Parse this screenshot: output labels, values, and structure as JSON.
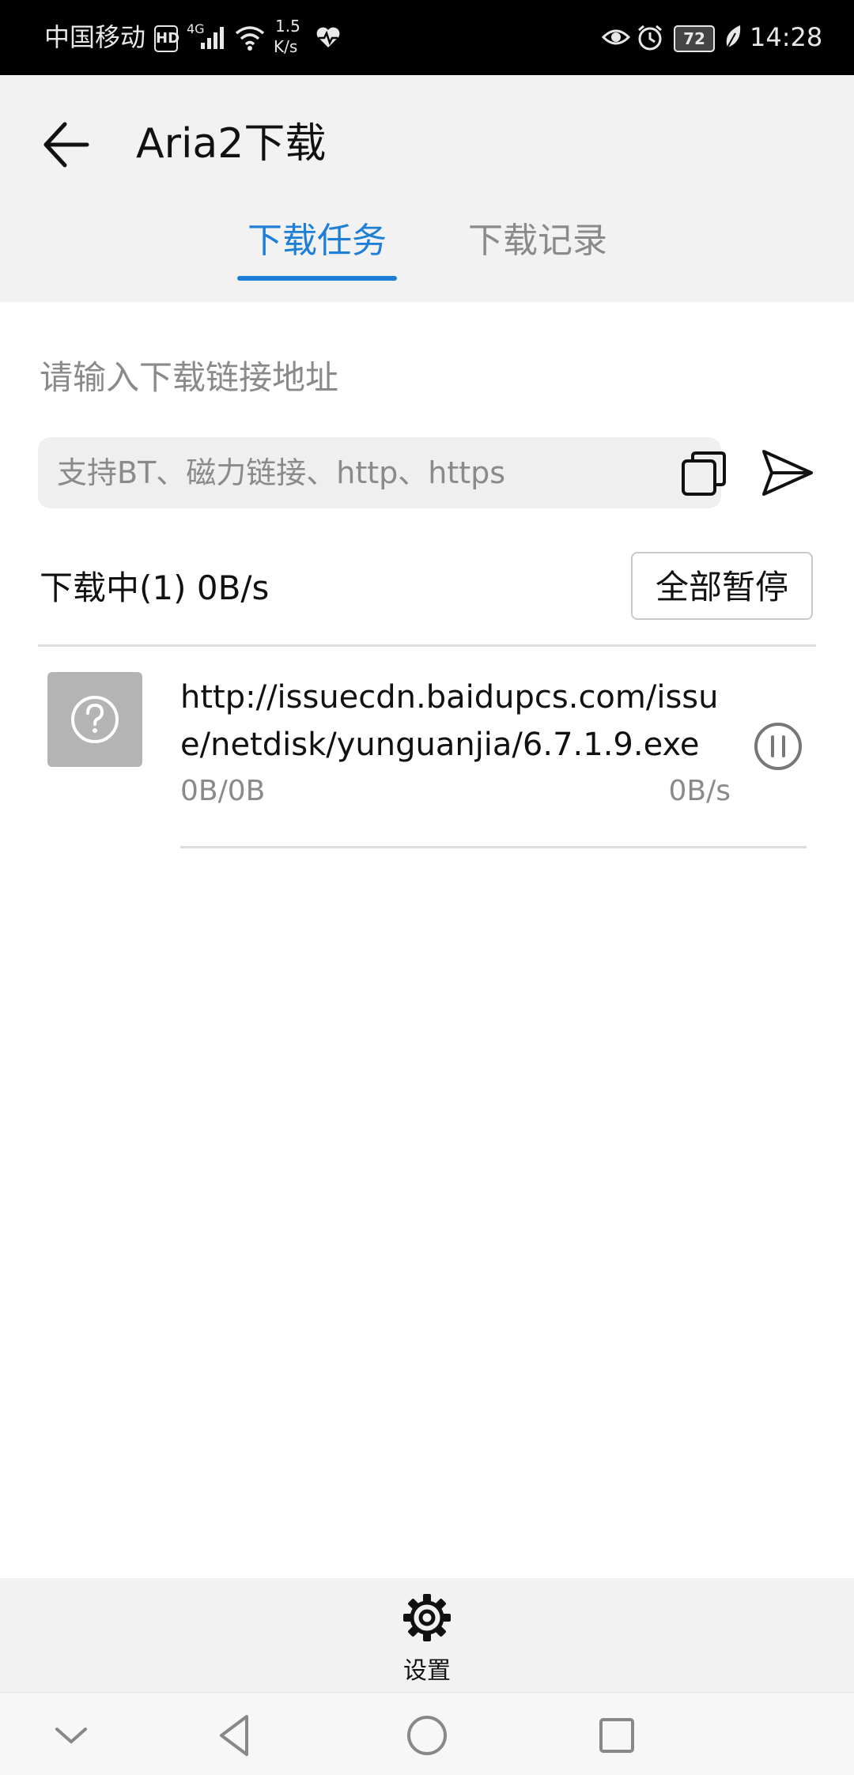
{
  "status_bar": {
    "carrier": "中国移动",
    "hd_badge": "HD",
    "network_type": "4G",
    "speed_value": "1.5",
    "speed_unit": "K/s",
    "battery": "72",
    "time": "14:28"
  },
  "app_bar": {
    "title": "Aria2下载",
    "back_icon": "arrow-left-icon"
  },
  "tabs": [
    {
      "label": "下载任务",
      "active": true
    },
    {
      "label": "下载记录",
      "active": false
    }
  ],
  "input": {
    "label": "请输入下载链接地址",
    "placeholder": "支持BT、磁力链接、http、https",
    "value": ""
  },
  "downloading": {
    "status": "下载中(1) 0B/s",
    "pause_all_label": "全部暂停"
  },
  "items": [
    {
      "name": "http://issuecdn.baidupcs.com/issue/netdisk/yunguanjia/6.7.1.9.exe",
      "size": "0B/0B",
      "speed": "0B/s"
    }
  ],
  "bottom_bar": {
    "settings_label": "设置"
  },
  "colors": {
    "accent": "#1e7fd6",
    "secondary_text": "#8a8a8a"
  }
}
